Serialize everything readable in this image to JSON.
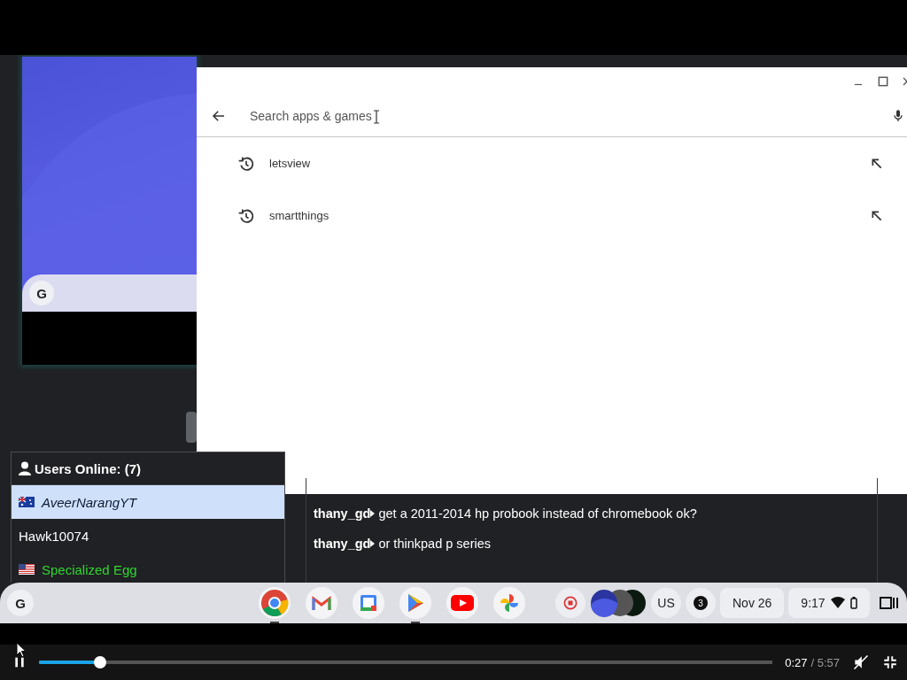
{
  "video_frame": {
    "background_window": {
      "search_logo": "G"
    },
    "store_window": {
      "search": {
        "placeholder": "Search apps & games"
      },
      "suggestions": [
        {
          "text": "letsview"
        },
        {
          "text": "smartthings"
        }
      ]
    },
    "users_panel": {
      "title": "Users Online: (7)",
      "users": [
        {
          "name": "AveerNarangYT",
          "kind": "au",
          "italic": true,
          "selected": true,
          "color": "#0e1a33"
        },
        {
          "name": "Hawk10074",
          "kind": "none",
          "italic": false,
          "selected": false,
          "color": "#ffffff"
        },
        {
          "name": "Specialized Egg",
          "kind": "us",
          "italic": false,
          "selected": false,
          "color": "#2fd62f"
        }
      ]
    },
    "chat": {
      "messages": [
        {
          "user": "thany_gd",
          "text": "get a 2011-2014 hp probook instead of chromebook ok?"
        },
        {
          "user": "thany_gd",
          "text": "or thinkpad p series"
        }
      ]
    },
    "shelf": {
      "launcher": "G",
      "apps": [
        {
          "kind": "wheel",
          "running": true
        },
        {
          "kind": "mail",
          "running": false
        },
        {
          "kind": "calendar",
          "running": false
        },
        {
          "kind": "play",
          "running": true
        },
        {
          "kind": "video",
          "running": false
        },
        {
          "kind": "pinwheel",
          "running": false
        }
      ],
      "ime": "US",
      "notifications": "3",
      "date": "Nov 26",
      "time": "9:17"
    }
  },
  "player": {
    "playing": true,
    "progress": {
      "level": 0.083
    },
    "time": "0:27",
    "duration": "/ 5:57"
  }
}
